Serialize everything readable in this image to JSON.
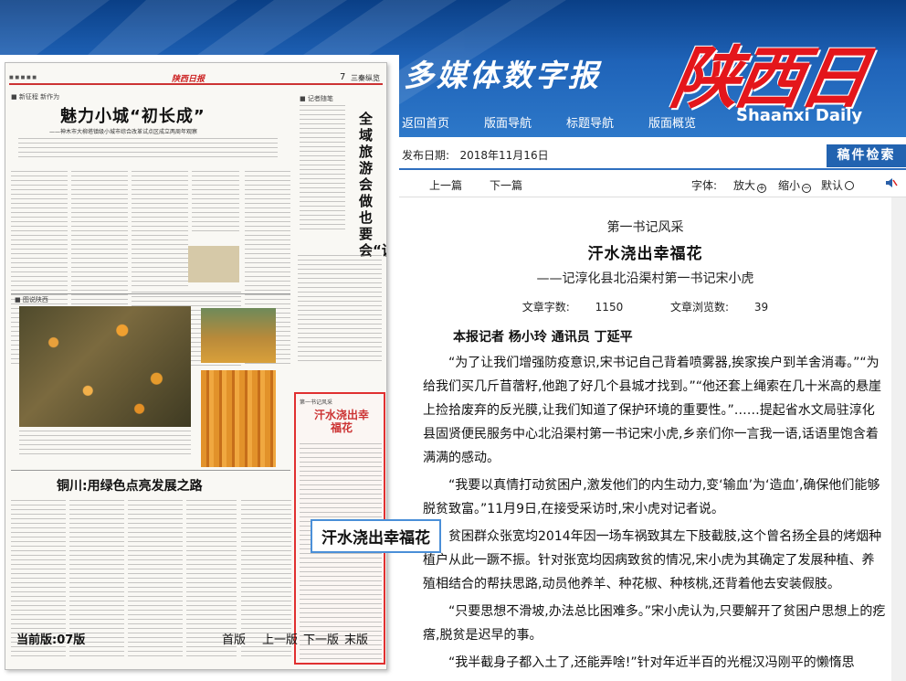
{
  "header": {
    "site_subtitle": "多媒体数字报",
    "logo_cn": "陕西日报",
    "logo_en": "Shaanxi Daily",
    "nav": [
      "返回首页",
      "版面导航",
      "标题导航",
      "版面概览"
    ]
  },
  "date_bar": {
    "label": "发布日期:",
    "date": "2018年11月16日",
    "search_button": "稿件检索"
  },
  "toolbar": {
    "prev": "上一篇",
    "next": "下一篇",
    "font_label": "字体:",
    "enlarge": "放大",
    "shrink": "缩小",
    "default": "默认"
  },
  "newspaper": {
    "masthead_small": "陕西日报",
    "page_no": "7",
    "page_section": "三秦纵览",
    "column_tag": "新征程 新作为",
    "headline": "魅力小城“初长成”",
    "subheadline": "——神木市大柳塔镇级小城市综合改革试点区成立两周年观察",
    "side_headline": "全域旅游会做也要会“说”",
    "side_tag": "记者随笔",
    "photo_tag": "图说陕西",
    "second_headline": "铜川:用绿色点亮发展之路",
    "box_tag": "第一书记风采",
    "box_title": "汗水浇出幸福花"
  },
  "highlight_label": "汗水浇出幸福花",
  "page_footer": {
    "current_page": "当前版:07版",
    "nav": [
      "首版",
      "上一版",
      "下一版",
      "末版"
    ]
  },
  "article": {
    "kicker": "第一书记风采",
    "title": "汗水浇出幸福花",
    "subtitle": "——记淳化县北沿渠村第一书记宋小虎",
    "word_count_label": "文章字数:",
    "word_count": "1150",
    "view_count_label": "文章浏览数:",
    "view_count": "39",
    "byline": "本报记者  杨小玲  通讯员  丁延平",
    "paragraphs": [
      "“为了让我们增强防疫意识,宋书记自己背着喷雾器,挨家挨户到羊舍消毒。”“为给我们买几斤苜蓿籽,他跑了好几个县城才找到。”“他还套上绳索在几十米高的悬崖上捡拾废弃的反光膜,让我们知道了保护环境的重要性。”……提起省水文局驻淳化县固贤便民服务中心北沿渠村第一书记宋小虎,乡亲们你一言我一语,话语里饱含着满满的感动。",
      "“我要以真情打动贫困户,激发他们的内生动力,变‘输血’为‘造血’,确保他们能够脱贫致富。”11月9日,在接受采访时,宋小虎对记者说。",
      "贫困群众张宽均2014年因一场车祸致其左下肢截肢,这个曾名扬全县的烤烟种植户从此一蹶不振。针对张宽均因病致贫的情况,宋小虎为其确定了发展种植、养殖相结合的帮扶思路,动员他养羊、种花椒、种核桃,还背着他去安装假肢。",
      "“只要思想不滑坡,办法总比困难多。”宋小虎认为,只要解开了贫困户思想上的疙瘩,脱贫是迟早的事。",
      "“我半截身子都入土了,还能弄啥!”针对年近半百的光棍汉冯刚平的懒惰思"
    ]
  }
}
